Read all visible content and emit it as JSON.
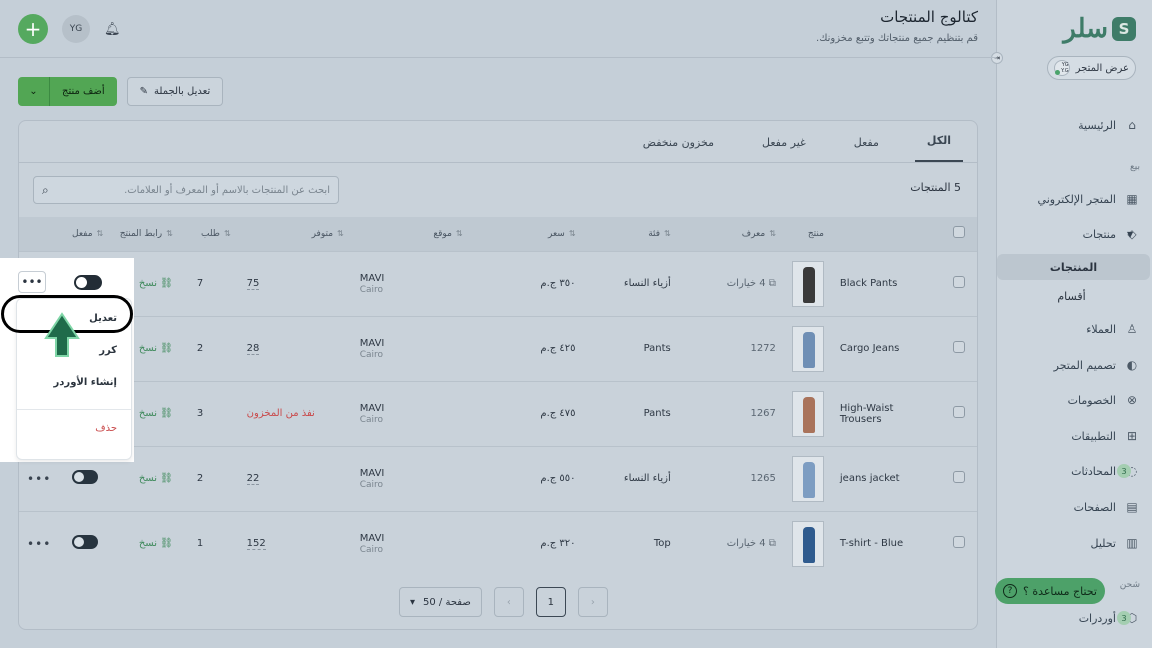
{
  "sidebar": {
    "logo_text": "سلر",
    "store_button": "عرض المتجر",
    "store_avatar": "YG Y.G",
    "nav": [
      {
        "label": "الرئيسية",
        "icon": "home-icon"
      },
      {
        "label": "المتجر الإلكتروني",
        "icon": "store-icon"
      },
      {
        "label": "منتجات",
        "icon": "tag-icon"
      },
      {
        "label": "العملاء",
        "icon": "user-icon"
      },
      {
        "label": "تصميم المتجر",
        "icon": "palette-icon"
      },
      {
        "label": "الخصومات",
        "icon": "discount-icon"
      },
      {
        "label": "التطبيقات",
        "icon": "apps-icon"
      },
      {
        "label": "المحادثات",
        "icon": "chat-icon",
        "badge": "3"
      },
      {
        "label": "الصفحات",
        "icon": "page-icon"
      },
      {
        "label": "تحليل",
        "icon": "chart-icon"
      },
      {
        "label": "أوردرات",
        "icon": "box-icon",
        "badge": "3"
      }
    ],
    "section_sell": "بيع",
    "section_ship": "شحن",
    "products_sub": [
      "المنتجات",
      "أقسام"
    ],
    "help": "تحتاج مساعدة ؟"
  },
  "header": {
    "title": "كتالوج المنتجات",
    "subtitle": "قم بتنظيم جميع منتجاتك وتتبع مخزونك.",
    "avatar": "YG"
  },
  "actions": {
    "add": "أضف منتج",
    "bulk": "تعديل بالجملة"
  },
  "tabs": [
    "الكل",
    "مفعل",
    "غير مفعل",
    "مخزون منخفض"
  ],
  "count": "5 المنتجات",
  "search": {
    "placeholder": "ابحث عن المنتجات بالاسم أو المعرف أو العلامات."
  },
  "columns": [
    "منتج",
    "معرف",
    "فئة",
    "سعر",
    "موقع",
    "متوفر",
    "طلب",
    "رابط المنتج",
    "مفعل"
  ],
  "rows": [
    {
      "name": "Black Pants",
      "id": "4 خيارات",
      "category": "أزياء النساء",
      "price": "٣٥٠ ج.م",
      "loc1": "MAVI",
      "loc2": "Cairo",
      "stock": "75",
      "orders": "7",
      "link": "نسخ",
      "color": "#3a3a3a"
    },
    {
      "name": "Cargo Jeans",
      "id": "1272",
      "category": "Pants",
      "price": "٤٢٥ ج.م",
      "loc1": "MAVI",
      "loc2": "Cairo",
      "stock": "28",
      "orders": "2",
      "link": "نسخ",
      "color": "#6f8fb5"
    },
    {
      "name": "High-Waist Trousers",
      "id": "1267",
      "category": "Pants",
      "price": "٤٧٥ ج.م",
      "loc1": "MAVI",
      "loc2": "Cairo",
      "stock": "نفذ من المخزون",
      "orders": "3",
      "link": "نسخ",
      "color": "#a9735b"
    },
    {
      "name": "jeans jacket",
      "id": "1265",
      "category": "أزياء النساء",
      "price": "٥٥٠ ج.م",
      "loc1": "MAVI",
      "loc2": "Cairo",
      "stock": "22",
      "orders": "2",
      "link": "نسخ",
      "color": "#7d9dc2"
    },
    {
      "name": "T-shirt - Blue",
      "id": "4 خيارات",
      "category": "Top",
      "price": "٣٢٠ ج.م",
      "loc1": "MAVI",
      "loc2": "Cairo",
      "stock": "152",
      "orders": "1",
      "link": "نسخ",
      "color": "#2f5b8e"
    }
  ],
  "pagination": {
    "current": "1",
    "page_size": "50 / صفحة"
  },
  "row_menu": {
    "edit": "تعديل",
    "duplicate": "كرر",
    "create_order": "إنشاء الأوردر",
    "delete": "حذف"
  },
  "colors": {
    "accent": "#52a654",
    "danger": "#c9494a"
  }
}
